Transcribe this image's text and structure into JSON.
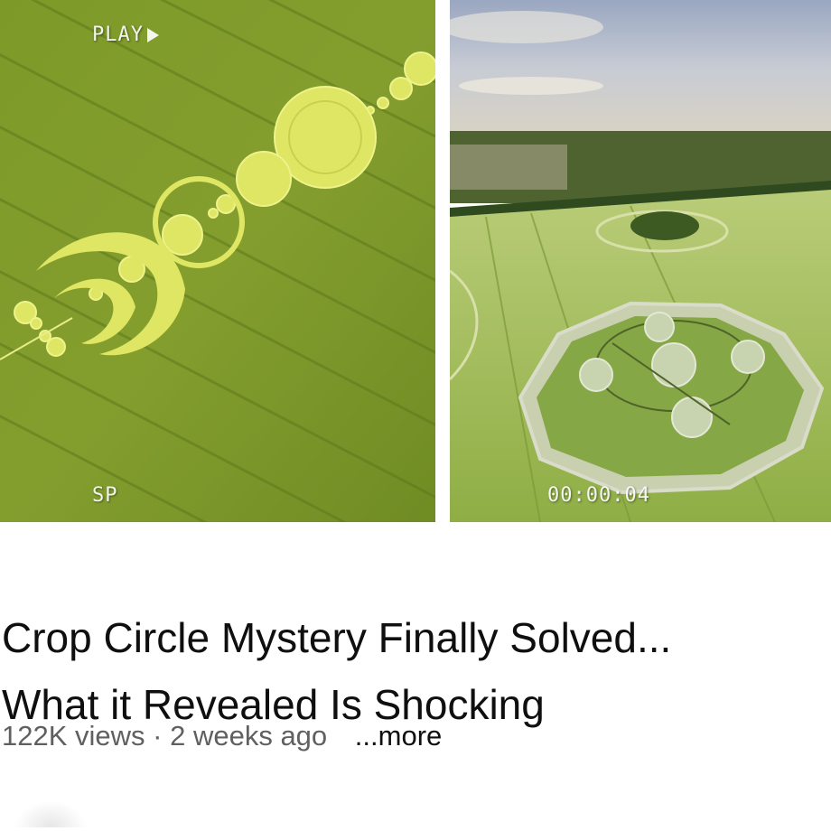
{
  "video": {
    "thumbnail_left": {
      "overlay_top": "PLAY",
      "overlay_bottom": "SP"
    },
    "thumbnail_right": {
      "timestamp": "00:00:04"
    },
    "title_line1": "Crop Circle Mystery Finally Solved...",
    "title_line2": "What it Revealed Is Shocking",
    "views": "122K views",
    "separator": "·",
    "age": "2 weeks ago",
    "more_label": "...more"
  },
  "colors": {
    "field_green": "#7f9a2a",
    "circle_yellow": "#e4ea6a",
    "sky": "#b9c3d6",
    "title_text": "#0f0f0f",
    "meta_text": "#606060"
  }
}
